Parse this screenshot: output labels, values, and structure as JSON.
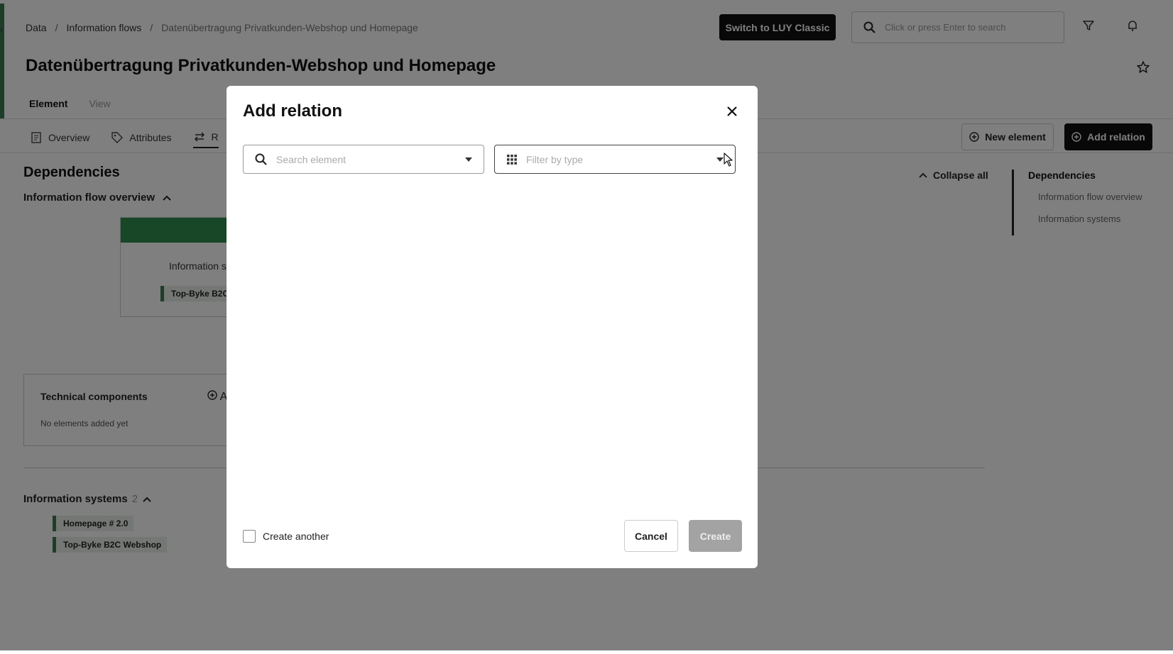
{
  "header": {
    "breadcrumb": [
      "Data",
      "Information flows",
      "Datenübertragung Privatkunden-Webshop und Homepage"
    ],
    "switch_label": "Switch to LUY Classic",
    "search_placeholder": "Click or press Enter to search",
    "title": "Datenübertragung Privatkunden-Webshop und Homepage",
    "view_tabs": [
      "Element",
      "View"
    ]
  },
  "tabs": [
    "Overview",
    "Attributes",
    "R"
  ],
  "actions": {
    "new_element": "New element",
    "add_relation": "Add relation"
  },
  "content": {
    "dependencies_title": "Dependencies",
    "flow_overview": "Information flow overview",
    "card_label": "Information s",
    "card_chip": "Top-Byke B2C",
    "tech_title": "Technical components",
    "tech_add": "A",
    "tech_empty": "No elements added yet",
    "is_title": "Information systems",
    "is_count": "2",
    "is_items": [
      "Homepage # 2.0",
      "Top-Byke B2C Webshop"
    ],
    "collapse_all": "Collapse all"
  },
  "toc": [
    "Dependencies",
    "Information flow overview",
    "Information systems"
  ],
  "modal": {
    "title": "Add relation",
    "search_placeholder": "Search element",
    "type_placeholder": "Filter by type",
    "create_another": "Create another",
    "cancel": "Cancel",
    "create": "Create"
  },
  "colors": {
    "accent_green": "#2f8f4f",
    "primary_dark": "#111111",
    "disabled": "#a3a3a3"
  }
}
